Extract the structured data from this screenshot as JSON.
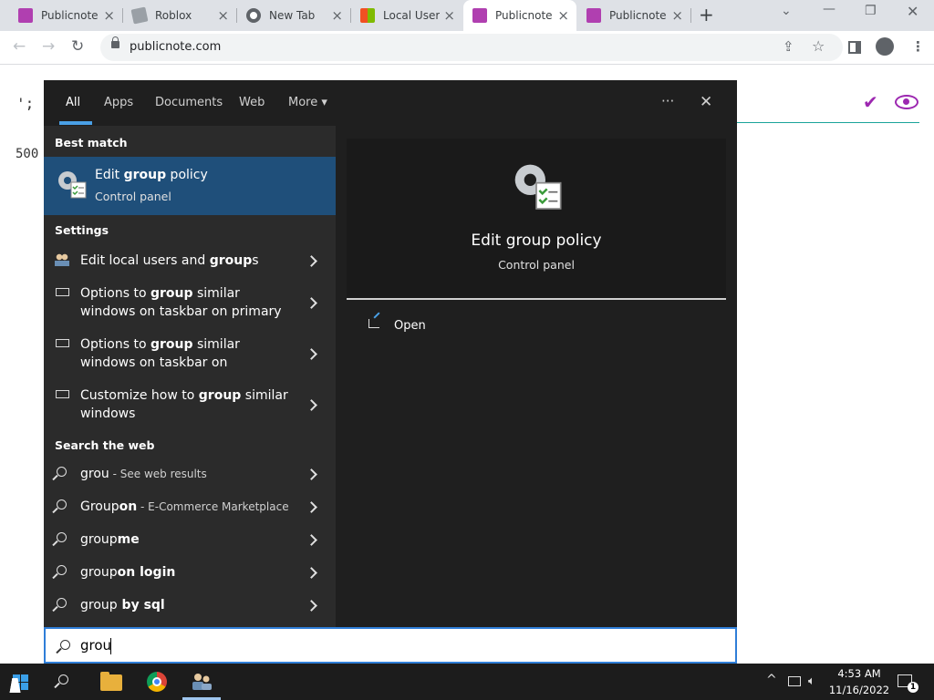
{
  "browser": {
    "tabs": [
      {
        "title": "Publicnote",
        "favicon": "publicnote-icon",
        "color": "#b03fb0",
        "active": false
      },
      {
        "title": "Roblox",
        "favicon": "roblox-icon",
        "color": "#9aa0a6",
        "active": false
      },
      {
        "title": "New Tab",
        "favicon": "chrome-icon",
        "color": "#5f6368",
        "active": false
      },
      {
        "title": "Local Users",
        "favicon": "windows-icon",
        "color": "#f25022",
        "active": false
      },
      {
        "title": "Publicnote",
        "favicon": "publicnote-icon",
        "color": "#b03fb0",
        "active": true
      },
      {
        "title": "Publicnote",
        "favicon": "publicnote-icon",
        "color": "#b03fb0",
        "active": false
      }
    ],
    "new_tab_symbol": "+",
    "url": "publicnote.com"
  },
  "page": {
    "code_line1": "';",
    "code_line2": "500"
  },
  "search_panel": {
    "tabs": [
      "All",
      "Apps",
      "Documents",
      "Web",
      "More"
    ],
    "more_caret": "▾",
    "more_options": "···",
    "close": "✕",
    "best_match_heading": "Best match",
    "best_match": {
      "title_pre": "Edit ",
      "title_bold": "group",
      "title_post": " policy",
      "subtitle": "Control panel"
    },
    "settings_heading": "Settings",
    "settings": [
      {
        "pre": "Edit local users and ",
        "bold": "group",
        "post": "s",
        "line2": ""
      },
      {
        "pre": "Options to ",
        "bold": "group",
        "post": " similar",
        "line2": "windows on taskbar on primary"
      },
      {
        "pre": "Options to ",
        "bold": "group",
        "post": " similar",
        "line2": "windows on taskbar on"
      },
      {
        "pre": "Customize how to ",
        "bold": "group",
        "post": " similar",
        "line2": "windows"
      }
    ],
    "web_heading": "Search the web",
    "web": [
      {
        "pre": "grou",
        "bold": "",
        "small": " - See web results"
      },
      {
        "pre": "Group",
        "bold": "on",
        "small": " - E-Commerce Marketplace"
      },
      {
        "pre": "group",
        "bold": "me",
        "small": ""
      },
      {
        "pre": "group",
        "bold": "on login",
        "small": ""
      },
      {
        "pre": "group",
        "bold": " by sql",
        "small": ""
      }
    ],
    "preview": {
      "title": "Edit group policy",
      "subtitle": "Control panel",
      "open_label": "Open"
    },
    "query": "grou"
  },
  "taskbar": {
    "time": "4:53 AM",
    "date": "11/16/2022",
    "tray_chevron": "^",
    "notification_count": "1"
  },
  "colors": {
    "highlight": "#1f4f7a",
    "accent": "#4aa0e6",
    "panel": "#2b2b2b",
    "publicnote": "#9c27b0"
  }
}
